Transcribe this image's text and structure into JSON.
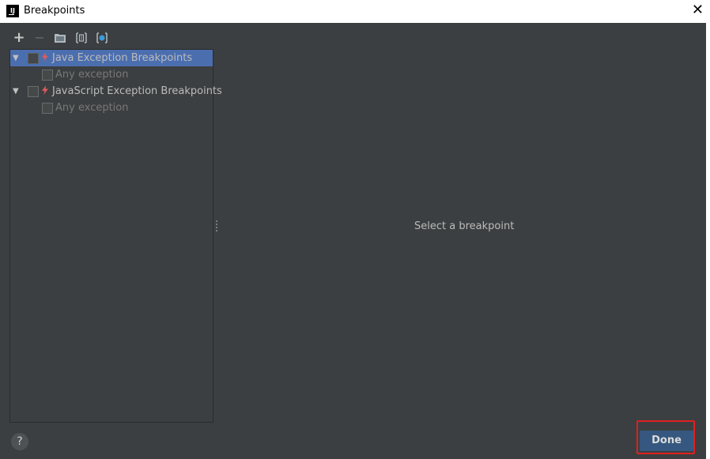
{
  "window": {
    "title": "Breakpoints",
    "close_glyph": "✕",
    "app_icon_text": "IJ"
  },
  "toolbar": {
    "add_glyph": "+",
    "remove_glyph": "−",
    "folder_icon": "folder-icon",
    "group_icon": "group-by-file-icon",
    "mute_icon": "mute-breakpoints-icon"
  },
  "tree": {
    "items": [
      {
        "label": "Java Exception Breakpoints",
        "selected": true,
        "icon": "lightning-icon",
        "checked": false
      },
      {
        "label": "Any exception",
        "checked": false
      },
      {
        "label": "JavaScript Exception Breakpoints",
        "selected": false,
        "icon": "lightning-icon",
        "checked": false
      },
      {
        "label": "Any exception",
        "checked": false
      }
    ]
  },
  "details": {
    "placeholder": "Select a breakpoint"
  },
  "footer": {
    "help_label": "?",
    "done_label": "Done"
  },
  "colors": {
    "background": "#3c3f41",
    "selection": "#4b6eaf",
    "done_button": "#365880",
    "annotation": "#e02020"
  }
}
